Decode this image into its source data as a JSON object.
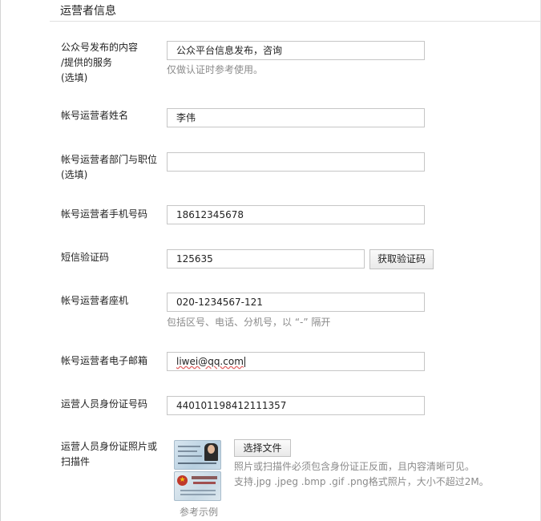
{
  "section": {
    "title": "运营者信息"
  },
  "fields": {
    "content": {
      "label_lines": [
        "公众号发布的内容",
        "/提供的服务",
        "(选填)"
      ],
      "value": "公众平台信息发布，咨询",
      "hint": "仅做认证时参考使用。"
    },
    "name": {
      "label": "帐号运营者姓名",
      "value": "李伟"
    },
    "dept": {
      "label_lines": [
        "帐号运营者部门与职位",
        "(选填)"
      ],
      "value": ""
    },
    "phone": {
      "label": "帐号运营者手机号码",
      "value": "18612345678"
    },
    "sms": {
      "label": "短信验证码",
      "value": "125635",
      "button": "获取验证码"
    },
    "landline": {
      "label": "帐号运营者座机",
      "value": "020-1234567-121",
      "hint": "包括区号、电话、分机号，以 “-” 隔开"
    },
    "email": {
      "label": "帐号运营者电子邮箱",
      "value": "liwei@qq.com"
    },
    "idnum": {
      "label": "运营人员身份证号码",
      "value": "440101198412111357"
    },
    "idphoto": {
      "label_lines": [
        "运营人员身份证照片或",
        "扫描件"
      ],
      "button": "选择文件",
      "hint_lines": [
        "照片或扫描件必须包含身份证正反面，且内容清晰可见。",
        "支持.jpg .jpeg .bmp .gif .png格式照片，大小不超过2M。"
      ],
      "sample_caption": "参考示例",
      "sample_icon": "id-card-sample-image"
    }
  }
}
